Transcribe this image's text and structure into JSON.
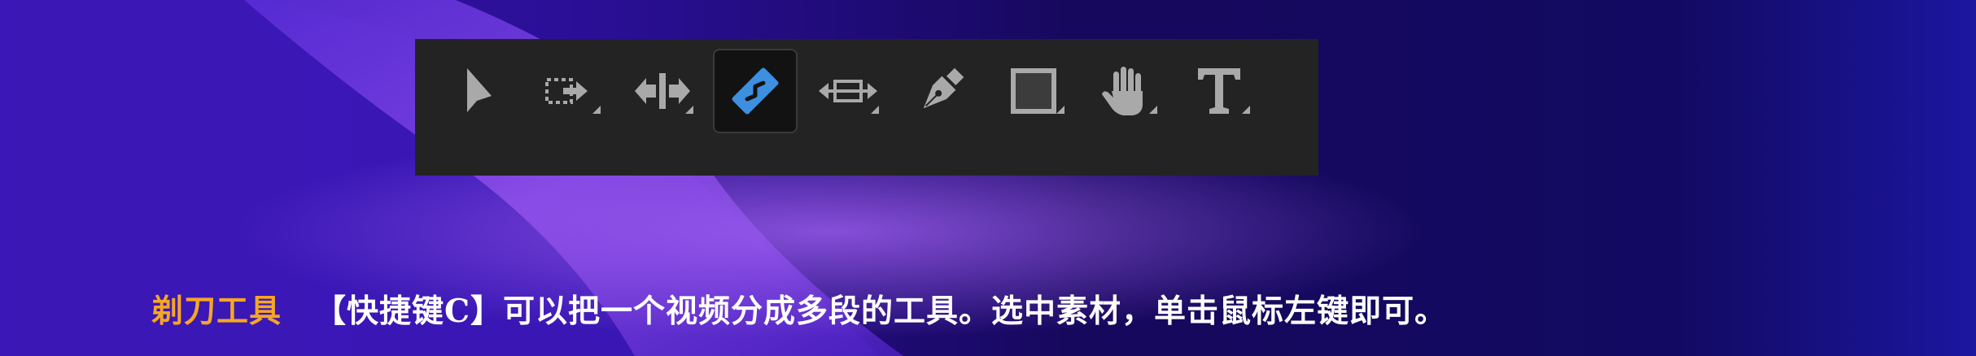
{
  "colors": {
    "toolbar_background": "#232323",
    "icon_gray": "#a9a9a9",
    "active_icon_blue": "#3d8fe0",
    "caption_title": "#f5a623",
    "caption_text": "#ffffff"
  },
  "toolbar": {
    "tools": [
      {
        "id": "selection",
        "icon": "arrow-cursor-icon",
        "active": false,
        "has_submenu": false
      },
      {
        "id": "track-select-forward",
        "icon": "track-select-forward-icon",
        "active": false,
        "has_submenu": true
      },
      {
        "id": "ripple-edit",
        "icon": "ripple-edit-icon",
        "active": false,
        "has_submenu": true
      },
      {
        "id": "razor",
        "icon": "razor-blade-icon",
        "active": true,
        "has_submenu": false
      },
      {
        "id": "slip",
        "icon": "slip-icon",
        "active": false,
        "has_submenu": true
      },
      {
        "id": "pen",
        "icon": "pen-icon",
        "active": false,
        "has_submenu": false
      },
      {
        "id": "rectangle",
        "icon": "rectangle-icon",
        "active": false,
        "has_submenu": true
      },
      {
        "id": "hand",
        "icon": "hand-icon",
        "active": false,
        "has_submenu": true
      },
      {
        "id": "type",
        "icon": "type-icon",
        "active": false,
        "has_submenu": true
      }
    ]
  },
  "caption": {
    "title": "剃刀工具",
    "description": "【快捷键C】可以把一个视频分成多段的工具。选中素材，单击鼠标左键即可。"
  }
}
